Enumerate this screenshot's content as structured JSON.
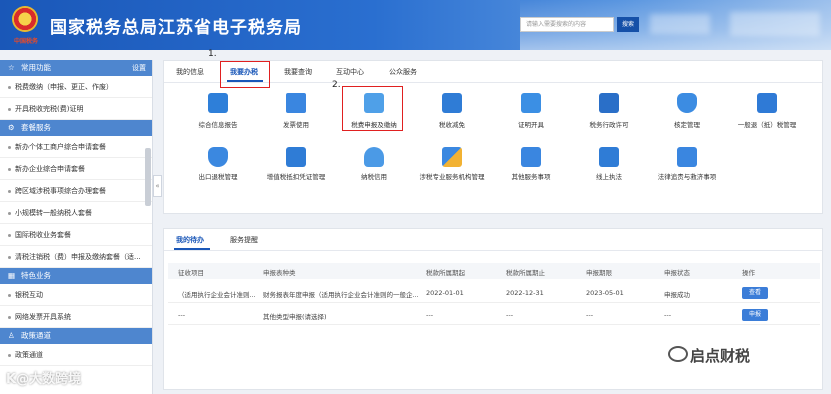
{
  "header": {
    "site_title": "国家税务总局江苏省电子税务局",
    "emblem_tag": "中国税务",
    "search_placeholder": "请输入需要搜索的内容",
    "search_button": "搜索"
  },
  "sidebar": {
    "common": {
      "title": "常用功能",
      "action": "设置"
    },
    "common_items": [
      "税费缴纳（申报、更正、作废）",
      "开具税收完税(费)证明"
    ],
    "tax_package": {
      "title": "套餐服务"
    },
    "package_items": [
      "新办个体工商户综合申请套餐",
      "新办企业综合申请套餐",
      "跨区域涉税事项综合办理套餐",
      "小规模转一般纳税人套餐",
      "国际税收业务套餐",
      "清税注销税（费）申报及缴纳套餐（适..."
    ],
    "special": {
      "title": "特色业务"
    },
    "special_items": [
      "银税互动",
      "网络发票开具系统"
    ],
    "policy": {
      "title": "政策通道"
    },
    "policy_items": [
      "政策通道"
    ]
  },
  "top_tabs": [
    "我的信息",
    "我要办税",
    "我要查询",
    "互动中心",
    "公众服务"
  ],
  "active_top_tab": "我要办税",
  "functions_row1": [
    "综合信息报告",
    "发票使用",
    "税费申报及缴纳",
    "税收减免",
    "证明开具",
    "税务行政许可",
    "核定管理",
    "一般退（抵）税管理"
  ],
  "functions_row2": [
    "出口退税管理",
    "增值税抵扣凭证管理",
    "纳税信用",
    "涉税专业服务机构管理",
    "其他服务事项",
    "线上执法",
    "法律追责与救济事项"
  ],
  "annotations": {
    "step1": "1.",
    "step2": "2."
  },
  "bottom_tabs": [
    "我的待办",
    "服务提醒"
  ],
  "table": {
    "headers": [
      "征收项目",
      "申报表种类",
      "税款所属期起",
      "税款所属期止",
      "申报期限",
      "申报状态",
      "操作"
    ],
    "rows": [
      {
        "item": "（适用执行企业会计准则...",
        "type": "财务报表年度申报（适用执行企业会计准则的一般企...",
        "start": "2022-01-01",
        "end": "2022-12-31",
        "deadline": "2023-05-01",
        "status": "申报成功",
        "op": "查看"
      },
      {
        "item": "---",
        "type": "其他类型申报(请选择)",
        "start": "---",
        "end": "---",
        "deadline": "---",
        "status": "---",
        "op": "申报"
      }
    ]
  },
  "watermark_right": "启点财税",
  "watermark_left": "K@大数跨境",
  "colors": {
    "primary": "#1a57b8",
    "highlight": "#e02020"
  }
}
